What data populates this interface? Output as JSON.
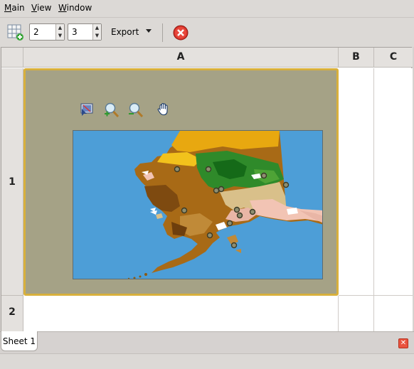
{
  "menu": {
    "items": [
      {
        "label": "Main",
        "underline": "M",
        "rest": "ain"
      },
      {
        "label": "View",
        "underline": "V",
        "rest": "iew"
      },
      {
        "label": "Window",
        "underline": "W",
        "rest": "indow"
      }
    ]
  },
  "toolbar": {
    "rows_value": "2",
    "cols_value": "3",
    "export_label": "Export"
  },
  "grid": {
    "columns": [
      "A",
      "B",
      "C"
    ],
    "rows": [
      "1",
      "2"
    ]
  },
  "plot_tools": [
    "select-export-icon",
    "zoom-in-icon",
    "zoom-out-icon",
    "pan-hand-icon"
  ],
  "tabs": [
    {
      "label": "Sheet 1"
    }
  ],
  "colors": {
    "frame_border": "#d8b03c",
    "plot_bg": "#a5a286",
    "water": "#4d9ed7"
  }
}
